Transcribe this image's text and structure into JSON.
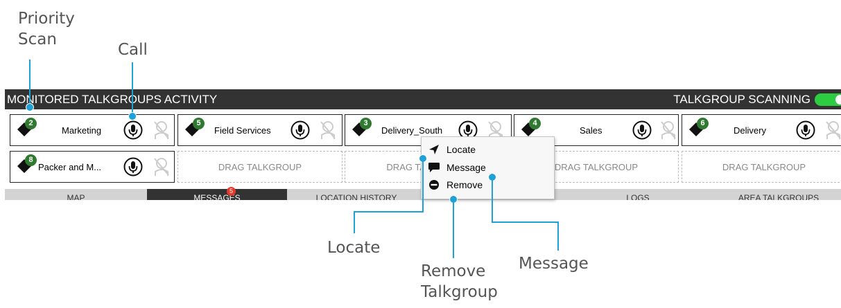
{
  "callouts": {
    "priority_scan": [
      "Priority",
      "Scan"
    ],
    "call": "Call",
    "locate": "Locate",
    "remove_talkgroup": [
      "Remove",
      "Talkgroup"
    ],
    "message": "Message"
  },
  "header": {
    "title": "MONITORED TALKGROUPS ACTIVITY",
    "scanning_label": "TALKGROUP SCANNING",
    "scanning_enabled": true
  },
  "talkgroups": [
    {
      "priority": "2",
      "name": "Marketing"
    },
    {
      "priority": "5",
      "name": "Field Services"
    },
    {
      "priority": "3",
      "name": "Delivery_South"
    },
    {
      "priority": "4",
      "name": "Sales"
    },
    {
      "priority": "6",
      "name": "Delivery"
    },
    {
      "priority": "8",
      "name": "Packer and M..."
    }
  ],
  "empty_slot_label": "DRAG TALKGROUP",
  "context_menu": {
    "locate": "Locate",
    "message": "Message",
    "remove": "Remove"
  },
  "tabs": [
    {
      "label": "MAP"
    },
    {
      "label": "MESSAGES",
      "badge": "5",
      "active": true
    },
    {
      "label": "LOCATION HISTORY"
    },
    {
      "label": ""
    },
    {
      "label": "LOGS"
    },
    {
      "label": "AREA TALKGROUPS"
    }
  ],
  "colors": {
    "accent": "#1ea1d6",
    "header_bg": "#333333",
    "priority_badge": "#2f7a30",
    "toggle_on": "#2ecc40",
    "tab_badge": "#e53a2a"
  },
  "icons": {
    "tag": "talkgroup-tag-icon",
    "call": "microphone-icon",
    "mute": "muted-speaker-icon",
    "locate": "locate-arrow-icon",
    "message": "speech-bubble-icon",
    "remove": "remove-circle-icon"
  }
}
